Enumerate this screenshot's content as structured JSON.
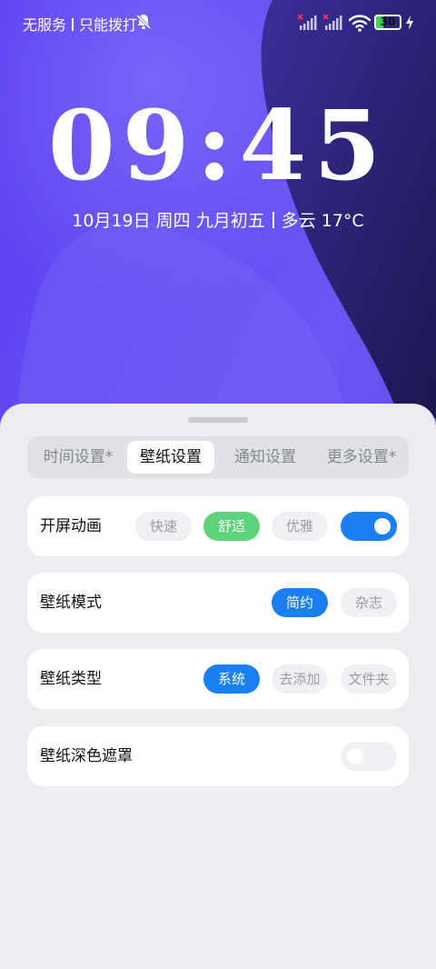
{
  "status_bar": {
    "carrier_1": "无服务",
    "carrier_2": "只能拨打",
    "battery_level": "30",
    "battery_fraction": 0.3,
    "battery_color": "#3fd35a"
  },
  "lock_screen": {
    "time": "09:45",
    "date": "10月19日 周四 九月初五",
    "weather": "多云 17°C"
  },
  "settings_sheet": {
    "tabs": [
      {
        "label": "时间设置*",
        "active": false
      },
      {
        "label": "壁纸设置",
        "active": true
      },
      {
        "label": "通知设置",
        "active": false
      },
      {
        "label": "更多设置*",
        "active": false
      }
    ],
    "rows": {
      "animation": {
        "label": "开屏动画",
        "options": [
          "快速",
          "舒适",
          "优雅"
        ],
        "selected": "舒适",
        "toggle_on": true
      },
      "mode": {
        "label": "壁纸模式",
        "options": [
          "简约",
          "杂志"
        ],
        "selected": "简约"
      },
      "type": {
        "label": "壁纸类型",
        "options": [
          "系统",
          "去添加",
          "文件夹"
        ],
        "selected": "系统"
      },
      "dark_mask": {
        "label": "壁纸深色遮罩",
        "toggle_on": false
      }
    }
  },
  "colors": {
    "accent_blue": "#1a80f2",
    "accent_green": "#5fd37b",
    "sheet_bg": "#ecedf1"
  }
}
